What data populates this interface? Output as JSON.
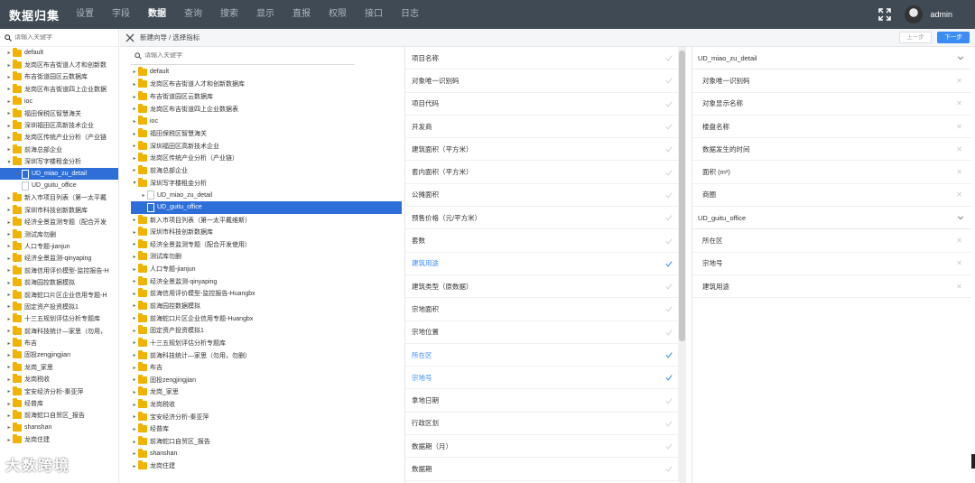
{
  "app": {
    "brand": "数据归集",
    "user": "admin"
  },
  "nav": [
    "设置",
    "字段",
    "数据",
    "查询",
    "搜索",
    "显示",
    "直报",
    "权限",
    "接口",
    "日志"
  ],
  "nav_active": 2,
  "left": {
    "search_placeholder": "请输入关键字",
    "items": [
      {
        "label": "default",
        "type": "folder",
        "level": 0,
        "caret": "▸"
      },
      {
        "label": "龙岗区布吉街道人才和创新数",
        "type": "folder",
        "level": 0,
        "caret": "▸"
      },
      {
        "label": "布吉街道园区云数据库",
        "type": "folder",
        "level": 0,
        "caret": "▸"
      },
      {
        "label": "龙岗区布吉街道四上企业数据",
        "type": "folder",
        "level": 0,
        "caret": "▸"
      },
      {
        "label": "ioc",
        "type": "folder",
        "level": 0,
        "caret": "▸"
      },
      {
        "label": "福田保税区智慧海关",
        "type": "folder",
        "level": 0,
        "caret": "▸"
      },
      {
        "label": "深圳福田区高新技术企业",
        "type": "folder",
        "level": 0,
        "caret": "▸"
      },
      {
        "label": "龙岗区传统产业分析（产业链",
        "type": "folder",
        "level": 0,
        "caret": "▸"
      },
      {
        "label": "前海总部企业",
        "type": "folder",
        "level": 0,
        "caret": "▸"
      },
      {
        "label": "深圳写字楼租金分析",
        "type": "folder",
        "level": 0,
        "caret": "▾"
      },
      {
        "label": "UD_miao_zu_detail",
        "type": "doc",
        "level": 1,
        "caret": "▸",
        "selected": true
      },
      {
        "label": "UD_guitu_office",
        "type": "doc",
        "level": 1,
        "caret": ""
      },
      {
        "label": "新入市项目列表（第一太平戴",
        "type": "folder",
        "level": 0,
        "caret": "▸"
      },
      {
        "label": "深圳市科技创新数据库",
        "type": "folder",
        "level": 0,
        "caret": "▸"
      },
      {
        "label": "经济全景监测专题（配合开发",
        "type": "folder",
        "level": 0,
        "caret": "▸"
      },
      {
        "label": "测试库勿删",
        "type": "folder",
        "level": 0,
        "caret": "▸"
      },
      {
        "label": "人口专题-jianjun",
        "type": "folder",
        "level": 0,
        "caret": "▸"
      },
      {
        "label": "经济全景监测-qinyaping",
        "type": "folder",
        "level": 0,
        "caret": "▸"
      },
      {
        "label": "前海信用评价模型-监控报告-H",
        "type": "folder",
        "level": 0,
        "caret": "▸"
      },
      {
        "label": "前海园控数据模拟",
        "type": "folder",
        "level": 0,
        "caret": "▸"
      },
      {
        "label": "前海蛇口片区企业信用专题-H",
        "type": "folder",
        "level": 0,
        "caret": "▸"
      },
      {
        "label": "固定资产投资模拟1",
        "type": "folder",
        "level": 0,
        "caret": "▸"
      },
      {
        "label": "十三五规划评估分析专题库",
        "type": "folder",
        "level": 0,
        "caret": "▸"
      },
      {
        "label": "前海科技统计—家思（勿用，",
        "type": "folder",
        "level": 0,
        "caret": "▸"
      },
      {
        "label": "布吉",
        "type": "folder",
        "level": 0,
        "caret": "▸"
      },
      {
        "label": "固投zengjingjian",
        "type": "folder",
        "level": 0,
        "caret": "▸"
      },
      {
        "label": "龙岗_家思",
        "type": "folder",
        "level": 0,
        "caret": "▸"
      },
      {
        "label": "龙岗税收",
        "type": "folder",
        "level": 0,
        "caret": "▸"
      },
      {
        "label": "宝安经济分析-秦亚萍",
        "type": "folder",
        "level": 0,
        "caret": "▸"
      },
      {
        "label": "经普库",
        "type": "folder",
        "level": 0,
        "caret": "▸"
      },
      {
        "label": "前海蛇口自贸区_报告",
        "type": "folder",
        "level": 0,
        "caret": "▸"
      },
      {
        "label": "shanshan",
        "type": "folder",
        "level": 0,
        "caret": "▸"
      },
      {
        "label": "龙岗住建",
        "type": "folder",
        "level": 0,
        "caret": "▸"
      }
    ]
  },
  "wizard": {
    "title": "新建向导 / 选择指标",
    "prev_label": "上一步",
    "next_label": "下一步"
  },
  "mid": {
    "search_placeholder": "请输入关键字",
    "items": [
      {
        "label": "default",
        "type": "folder",
        "level": 0,
        "caret": "▸"
      },
      {
        "label": "龙岗区布吉街道人才和创新数据库",
        "type": "folder",
        "level": 0,
        "caret": "▸"
      },
      {
        "label": "布吉街道园区云数据库",
        "type": "folder",
        "level": 0,
        "caret": "▸"
      },
      {
        "label": "龙岗区布吉街道四上企业数据表",
        "type": "folder",
        "level": 0,
        "caret": "▸"
      },
      {
        "label": "ioc",
        "type": "folder",
        "level": 0,
        "caret": "▸"
      },
      {
        "label": "福田保税区智慧海关",
        "type": "folder",
        "level": 0,
        "caret": "▸"
      },
      {
        "label": "深圳福田区高新技术企业",
        "type": "folder",
        "level": 0,
        "caret": "▸"
      },
      {
        "label": "龙岗区传统产业分析（产业链）",
        "type": "folder",
        "level": 0,
        "caret": "▸"
      },
      {
        "label": "前海总部企业",
        "type": "folder",
        "level": 0,
        "caret": "▸"
      },
      {
        "label": "深圳写字楼租金分析",
        "type": "folder",
        "level": 0,
        "caret": "▾"
      },
      {
        "label": "UD_miao_zu_detail",
        "type": "doc",
        "level": 1,
        "caret": "▸"
      },
      {
        "label": "UD_guitu_office",
        "type": "doc",
        "level": 1,
        "caret": "",
        "selected": true
      },
      {
        "label": "新入市项目列表（第一太平戴维斯）",
        "type": "folder",
        "level": 0,
        "caret": "▸"
      },
      {
        "label": "深圳市科技创新数据库",
        "type": "folder",
        "level": 0,
        "caret": "▸"
      },
      {
        "label": "经济全景监测专题（配合开发使用）",
        "type": "folder",
        "level": 0,
        "caret": "▸"
      },
      {
        "label": "测试库勿删",
        "type": "folder",
        "level": 0,
        "caret": "▸"
      },
      {
        "label": "人口专题-jianjun",
        "type": "folder",
        "level": 0,
        "caret": "▸"
      },
      {
        "label": "经济全景监测-qinyaping",
        "type": "folder",
        "level": 0,
        "caret": "▸"
      },
      {
        "label": "前海信用评价模型-监控报告-Huangbx",
        "type": "folder",
        "level": 0,
        "caret": "▸"
      },
      {
        "label": "前海园控数据模拟",
        "type": "folder",
        "level": 0,
        "caret": "▸"
      },
      {
        "label": "前海蛇口片区企业信用专题-Huangbx",
        "type": "folder",
        "level": 0,
        "caret": "▸"
      },
      {
        "label": "固定资产投资模拟1",
        "type": "folder",
        "level": 0,
        "caret": "▸"
      },
      {
        "label": "十三五规划评估分析专题库",
        "type": "folder",
        "level": 0,
        "caret": "▸"
      },
      {
        "label": "前海科技统计—家思（勿用，勿删）",
        "type": "folder",
        "level": 0,
        "caret": "▸"
      },
      {
        "label": "布吉",
        "type": "folder",
        "level": 0,
        "caret": "▸"
      },
      {
        "label": "固投zengjingjian",
        "type": "folder",
        "level": 0,
        "caret": "▸"
      },
      {
        "label": "龙岗_家思",
        "type": "folder",
        "level": 0,
        "caret": "▸"
      },
      {
        "label": "龙岗税收",
        "type": "folder",
        "level": 0,
        "caret": "▸"
      },
      {
        "label": "宝安经济分析-秦亚萍",
        "type": "folder",
        "level": 0,
        "caret": "▸"
      },
      {
        "label": "经普库",
        "type": "folder",
        "level": 0,
        "caret": "▸"
      },
      {
        "label": "前海蛇口自贸区_报告",
        "type": "folder",
        "level": 0,
        "caret": "▸"
      },
      {
        "label": "shanshan",
        "type": "folder",
        "level": 0,
        "caret": "▸"
      },
      {
        "label": "龙岗住建",
        "type": "folder",
        "level": 0,
        "caret": "▸"
      }
    ]
  },
  "fields": [
    {
      "label": "项目名称",
      "checked": false
    },
    {
      "label": "对象唯一识别码",
      "checked": false
    },
    {
      "label": "项目代码",
      "checked": false
    },
    {
      "label": "开发商",
      "checked": false
    },
    {
      "label": "建筑面积（平方米）",
      "checked": false
    },
    {
      "label": "套内面积（平方米）",
      "checked": false
    },
    {
      "label": "公摊面积",
      "checked": false
    },
    {
      "label": "预售价格（元/平方米）",
      "checked": false
    },
    {
      "label": "套数",
      "checked": false
    },
    {
      "label": "建筑用途",
      "checked": true
    },
    {
      "label": "建筑类型（原数据）",
      "checked": false
    },
    {
      "label": "宗地面积",
      "checked": false
    },
    {
      "label": "宗地位置",
      "checked": false
    },
    {
      "label": "所在区",
      "checked": true
    },
    {
      "label": "宗地号",
      "checked": true
    },
    {
      "label": "拿地日期",
      "checked": false
    },
    {
      "label": "行政区划",
      "checked": false
    },
    {
      "label": "数据期（月）",
      "checked": false
    },
    {
      "label": "数据期",
      "checked": false
    }
  ],
  "selected_groups": [
    {
      "name": "UD_miao_zu_detail",
      "items": [
        "对象唯一识别码",
        "对象显示名称",
        "楼盘名称",
        "数据发生的时间",
        "面积 (m²)",
        "商圈"
      ]
    },
    {
      "name": "UD_guitu_office",
      "items": [
        "所在区",
        "宗地号",
        "建筑用途"
      ]
    }
  ],
  "watermark": "大数跨境",
  "colors": {
    "topbar": "#3f4a54",
    "accent": "#3b8cf5",
    "selected": "#2d6ed8",
    "folder": "#f0b400"
  }
}
